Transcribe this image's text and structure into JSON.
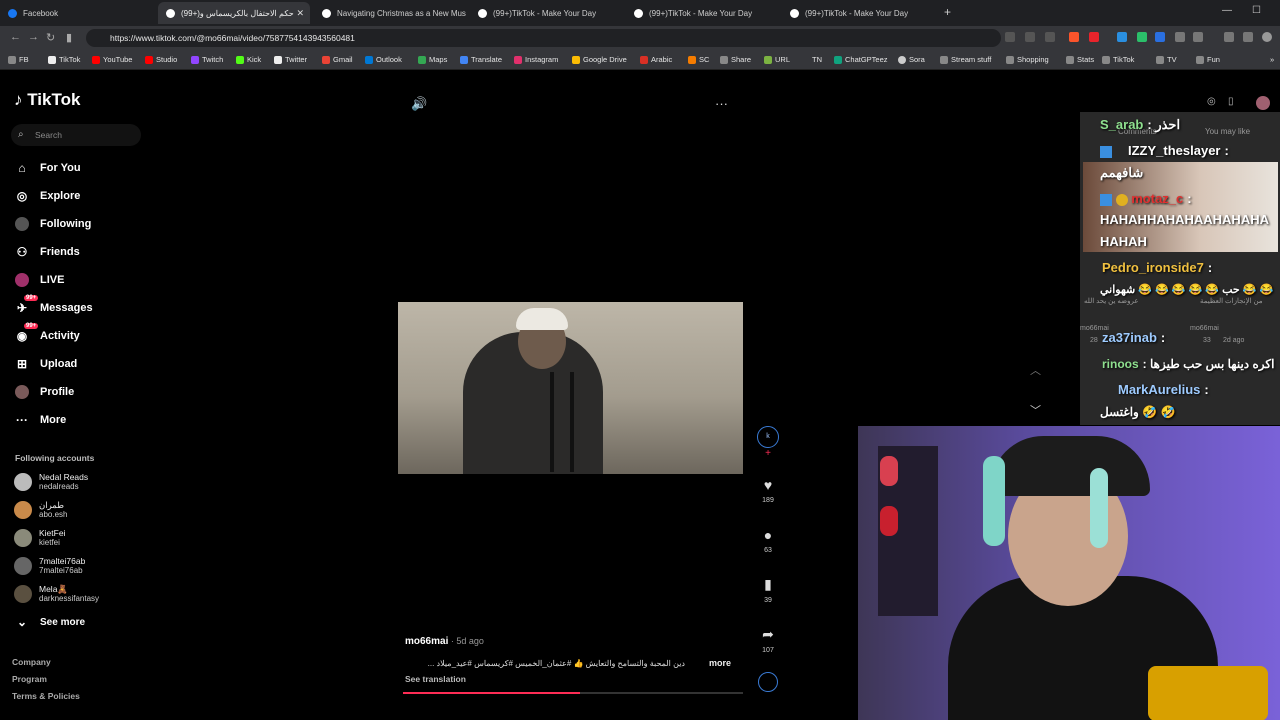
{
  "browser": {
    "tabs": [
      {
        "title": "Facebook",
        "color": "#1877f2"
      },
      {
        "title": "(99+)حكم الاحتفال بالكريسماس و",
        "color": "#ffffff"
      },
      {
        "title": "Navigating Christmas as a New Musl",
        "color": "#ffffff"
      },
      {
        "title": "(99+)TikTok - Make Your Day",
        "color": "#ffffff"
      },
      {
        "title": "(99+)TikTok - Make Your Day",
        "color": "#ffffff"
      },
      {
        "title": "(99+)TikTok - Make Your Day",
        "color": "#ffffff"
      }
    ],
    "url": "https://www.tiktok.com/@mo66mai/video/7587754143943560481",
    "bookmarks": [
      "FB",
      "TikTok",
      "YouTube",
      "Studio",
      "Twitch",
      "Kick",
      "Twitter",
      "Gmail",
      "Outlook",
      "Maps",
      "Translate",
      "Instagram",
      "Google Drive",
      "Arabic",
      "SC",
      "Share",
      "URL",
      "TN",
      "ChatGPTeez",
      "Sora",
      "Stream stuff",
      "Shopping",
      "Stats",
      "TikTok",
      "TV",
      "Fun"
    ]
  },
  "sidebar": {
    "logo": "TikTok",
    "search_placeholder": "Search",
    "items": [
      {
        "label": "For You",
        "icon": "home-icon"
      },
      {
        "label": "Explore",
        "icon": "compass-icon"
      },
      {
        "label": "Following",
        "icon": "following-icon"
      },
      {
        "label": "Friends",
        "icon": "friends-icon"
      },
      {
        "label": "LIVE",
        "icon": "live-icon"
      },
      {
        "label": "Messages",
        "icon": "messages-icon",
        "badge": "99+"
      },
      {
        "label": "Activity",
        "icon": "activity-icon",
        "badge": "99+"
      },
      {
        "label": "Upload",
        "icon": "upload-icon"
      },
      {
        "label": "Profile",
        "icon": "profile-icon"
      },
      {
        "label": "More",
        "icon": "more-icon"
      }
    ],
    "following_heading": "Following accounts",
    "accounts": [
      {
        "name": "Nedal Reads",
        "handle": "nedalreads"
      },
      {
        "name": "طمران",
        "handle": "abo.esh"
      },
      {
        "name": "KietFei",
        "handle": "kietfei"
      },
      {
        "name": "7maltei76ab",
        "handle": "7maltei76ab"
      },
      {
        "name": "Mela🧸",
        "handle": "darknessifantasy"
      }
    ],
    "see_more": "See more",
    "footer": [
      "Company",
      "Program",
      "Terms & Policies"
    ]
  },
  "video": {
    "author": "mo66mai",
    "age": " · 5d ago",
    "caption": "دين المحبة والتسامح والتعايش 👍 #عثمان_الخميس #كريسماس #عيد_ميلاد ...",
    "more": "more",
    "see_translation": "See translation",
    "progress": 0.52,
    "likes": "189",
    "comments": "63",
    "saves": "39",
    "shares": "107"
  },
  "right_panel": {
    "comments_tab": "Comments",
    "you_may_like_tab": "You may like"
  },
  "chat": [
    {
      "user": "S_arab",
      "msg": "احذر",
      "color": "#8fe08f"
    },
    {
      "user": "IZZY_theslayer",
      "msg": "شافهمم",
      "color": "#ffffff"
    },
    {
      "user": "motaz_c",
      "msg": "HAHAHHAHAHAAHAHAHAHAHAH",
      "color": "#e03030"
    },
    {
      "user": "Pedro_ironside7",
      "msg": "حب 😂 😂 😂 😂 😂 شهواني 😂 😂",
      "color": "#f0c040"
    },
    {
      "user": "za37inab",
      "msg": "",
      "color": "#9ecbff"
    },
    {
      "user": "rinoos",
      "msg": "اكره دينها بس حب طيزها",
      "color": "#8fe08f"
    },
    {
      "user": "MarkAurelius",
      "msg": "واغتسل 🤣 🤣",
      "color": "#9ecbff"
    }
  ],
  "chat_background": {
    "faint_left": "عروضه ين يحد الله",
    "faint_right": "من الإنجازات العظيمة",
    "faint_user1": "mo66mai",
    "faint_user2": "mo66mai",
    "faint_likes1": "28",
    "faint_likes2": "33",
    "faint_date": "2d ago"
  }
}
